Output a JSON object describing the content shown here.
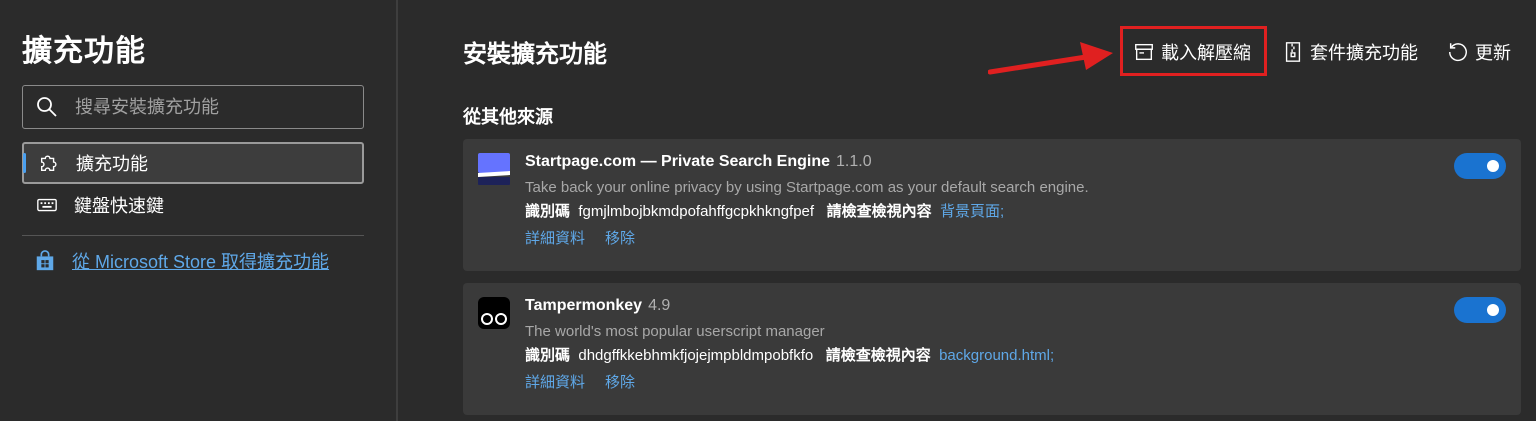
{
  "sidebar": {
    "title": "擴充功能",
    "search_placeholder": "搜尋安裝擴充功能",
    "items": [
      {
        "label": "擴充功能",
        "icon": "puzzle-icon",
        "active": true
      },
      {
        "label": "鍵盤快速鍵",
        "icon": "keyboard-icon",
        "active": false
      }
    ],
    "store_link": "從 Microsoft Store 取得擴充功能"
  },
  "main": {
    "title": "安裝擴充功能",
    "toolbar": {
      "load_unpacked": "載入解壓縮",
      "pack": "套件擴充功能",
      "update": "更新"
    },
    "section_title": "從其他來源",
    "extensions": [
      {
        "name": "Startpage.com — Private Search Engine",
        "version": "1.1.0",
        "description": "Take back your online privacy by using Startpage.com as your default search engine.",
        "id_label": "識別碼",
        "id": "fgmjlmbojbkmdpofahffgcpkhkngfpef",
        "inspect_label": "請檢查檢視內容",
        "inspect_link": "背景頁面;",
        "details": "詳細資料",
        "remove": "移除",
        "enabled": true
      },
      {
        "name": "Tampermonkey",
        "version": "4.9",
        "description": "The world's most popular userscript manager",
        "id_label": "識別碼",
        "id": "dhdgffkkebhmkfjojejmpbldmpobfkfo",
        "inspect_label": "請檢查檢視內容",
        "inspect_link": "background.html;",
        "details": "詳細資料",
        "remove": "移除",
        "enabled": true
      }
    ]
  },
  "colors": {
    "background": "#2b2b2b",
    "card": "#3a3a3a",
    "link": "#5fa8e8",
    "toggle_on": "#1a73d0",
    "annotation": "#e02020"
  }
}
